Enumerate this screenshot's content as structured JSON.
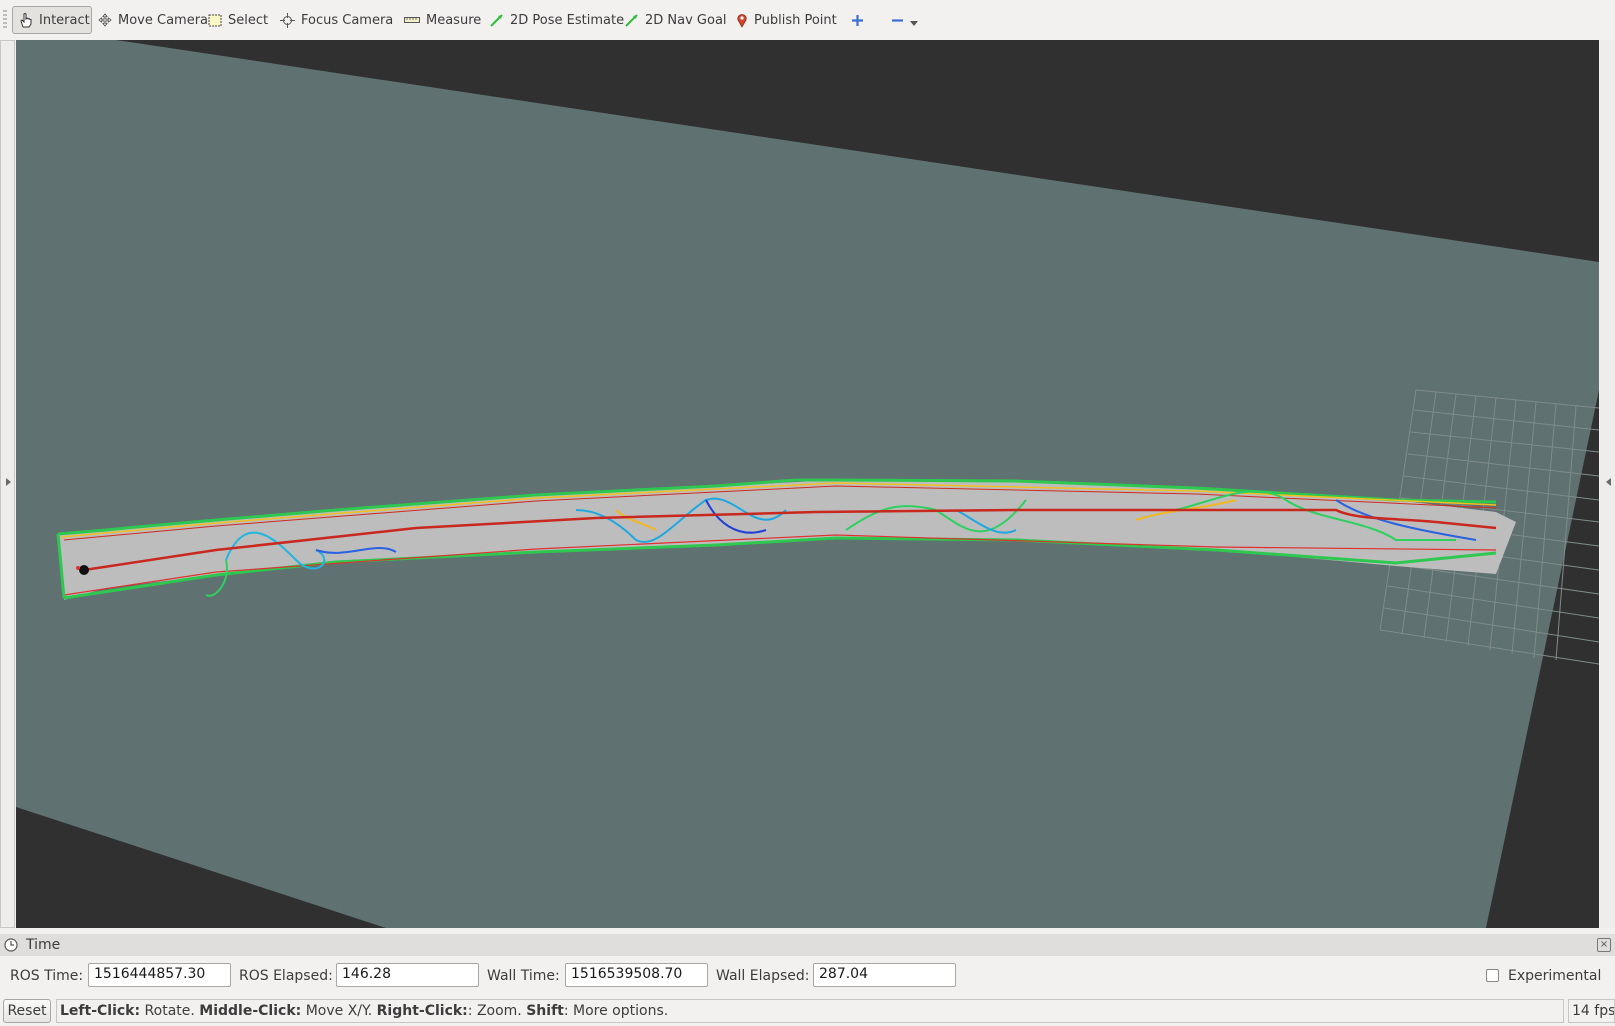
{
  "toolbar": {
    "tools": [
      {
        "label": "Interact",
        "icon": "hand-cursor-icon",
        "active": true
      },
      {
        "label": "Move Camera",
        "icon": "move-arrows-icon"
      },
      {
        "label": "Select",
        "icon": "selection-box-icon"
      },
      {
        "label": "Focus Camera",
        "icon": "crosshair-icon"
      },
      {
        "label": "Measure",
        "icon": "ruler-icon"
      },
      {
        "label": "2D Pose Estimate",
        "icon": "green-arrow-icon"
      },
      {
        "label": "2D Nav Goal",
        "icon": "green-arrow-icon"
      },
      {
        "label": "Publish Point",
        "icon": "map-pin-icon"
      }
    ],
    "add_icon": "plus-icon",
    "remove_icon": "minus-icon",
    "dropdown_icon": "chevron-down-icon"
  },
  "viewport": {
    "background_color": "#303030",
    "map_color": "#5f7170",
    "corridor_color": "#bdbdbd",
    "path_color": "#c8281e"
  },
  "time_panel": {
    "title": "Time",
    "ros_time_label": "ROS Time:",
    "ros_time_value": "1516444857.30",
    "ros_elapsed_label": "ROS Elapsed:",
    "ros_elapsed_value": "146.28",
    "wall_time_label": "Wall Time:",
    "wall_time_value": "1516539508.70",
    "wall_elapsed_label": "Wall Elapsed:",
    "wall_elapsed_value": "287.04",
    "experimental_label": "Experimental",
    "experimental_checked": false
  },
  "status_bar": {
    "reset_label": "Reset",
    "hint": [
      {
        "bold": "Left-Click:",
        "text": " Rotate. "
      },
      {
        "bold": "Middle-Click:",
        "text": " Move X/Y. "
      },
      {
        "bold": "Right-Click:",
        "text": ": Zoom. "
      },
      {
        "bold": "Shift",
        "text": ": More options."
      }
    ],
    "fps": "14 fps"
  }
}
